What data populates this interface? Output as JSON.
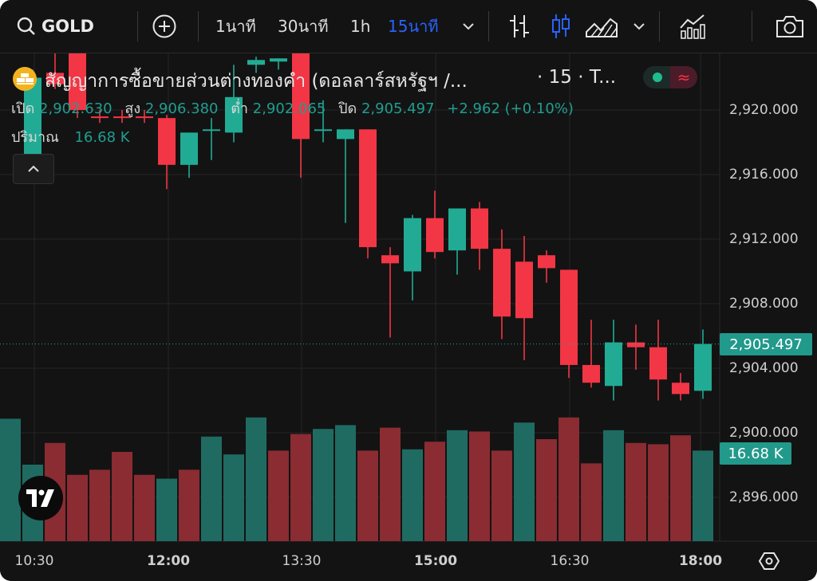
{
  "toolbar": {
    "symbol": "GOLD",
    "intervals": [
      "1นาที",
      "30นาที",
      "1h",
      "15นาที"
    ],
    "active_interval_color": "#2962ff",
    "icons": [
      "search-icon",
      "add-icon",
      "chevron-down-icon",
      "bar-chart-type-icon",
      "candlestick-icon",
      "area-chart-icon",
      "indicators-icon",
      "camera-icon"
    ]
  },
  "legend": {
    "title": "สัญญาการซื้อขายส่วนต่างทองคำ (ดอลลาร์สหรัฐฯ /...",
    "suffix": "· 15 · T...",
    "open_label": "เปิด",
    "open": "2,902.630",
    "high_label": "สูง",
    "high": "2,906.380",
    "low_label": "ต่ำ",
    "low": "2,902.065",
    "close_label": "ปิด",
    "close": "2,905.497",
    "change": "+2.962 (+0.10%)",
    "volume_label": "ปริมาณ",
    "volume": "16.68 K"
  },
  "price_badge": "2,905.497",
  "volume_badge": "16.68 K",
  "colors": {
    "up": "#22ab94",
    "down": "#f23645",
    "bg": "#131313",
    "grid": "#262626",
    "text": "#d1d4dc"
  },
  "chart_data": {
    "type": "candlestick",
    "x_ticks": [
      "10:30",
      "12:00",
      "13:30",
      "15:00",
      "16:30",
      "18:00"
    ],
    "y_ticks": [
      "2,920.000",
      "2,916.000",
      "2,912.000",
      "2,908.000",
      "2,904.000",
      "2,900.000",
      "2,896.000"
    ],
    "ylim": [
      2893.5,
      2924.8
    ],
    "last_price": 2905.497,
    "candles": [
      {
        "o": 2916.5,
        "h": 2922.5,
        "l": 2915.5,
        "c": 2922.0
      },
      {
        "o": 2922.3,
        "h": 2923.5,
        "l": 2921.3,
        "c": 2921.6
      },
      {
        "o": 2926.0,
        "h": 2926.5,
        "l": 2919.5,
        "c": 2920.0
      },
      {
        "o": 2919.6,
        "h": 2920.0,
        "l": 2919.2,
        "c": 2919.5
      },
      {
        "o": 2919.6,
        "h": 2920.0,
        "l": 2919.2,
        "c": 2919.5
      },
      {
        "o": 2919.6,
        "h": 2920.0,
        "l": 2919.2,
        "c": 2919.5
      },
      {
        "o": 2919.5,
        "h": 2919.7,
        "l": 2915.1,
        "c": 2916.6
      },
      {
        "o": 2916.6,
        "h": 2918.6,
        "l": 2915.8,
        "c": 2918.6
      },
      {
        "o": 2918.8,
        "h": 2919.5,
        "l": 2916.9,
        "c": 2918.8
      },
      {
        "o": 2918.6,
        "h": 2922.8,
        "l": 2918.0,
        "c": 2920.8
      },
      {
        "o": 2922.8,
        "h": 2923.3,
        "l": 2922.3,
        "c": 2923.1
      },
      {
        "o": 2923.0,
        "h": 2923.2,
        "l": 2922.5,
        "c": 2923.2
      },
      {
        "o": 2925.0,
        "h": 2925.5,
        "l": 2915.8,
        "c": 2918.2
      },
      {
        "o": 2918.8,
        "h": 2920.6,
        "l": 2918.0,
        "c": 2918.8
      },
      {
        "o": 2918.2,
        "h": 2918.8,
        "l": 2913.0,
        "c": 2918.8
      },
      {
        "o": 2918.8,
        "h": 2918.8,
        "l": 2910.8,
        "c": 2911.5
      },
      {
        "o": 2911.0,
        "h": 2911.5,
        "l": 2905.9,
        "c": 2910.5
      },
      {
        "o": 2910.0,
        "h": 2913.5,
        "l": 2908.2,
        "c": 2913.3
      },
      {
        "o": 2913.3,
        "h": 2915.0,
        "l": 2910.8,
        "c": 2911.2
      },
      {
        "o": 2911.3,
        "h": 2913.9,
        "l": 2909.8,
        "c": 2913.9
      },
      {
        "o": 2913.9,
        "h": 2914.3,
        "l": 2910.1,
        "c": 2911.4
      },
      {
        "o": 2911.4,
        "h": 2912.6,
        "l": 2905.8,
        "c": 2907.2
      },
      {
        "o": 2910.6,
        "h": 2912.2,
        "l": 2904.5,
        "c": 2907.1
      },
      {
        "o": 2911.0,
        "h": 2911.3,
        "l": 2909.3,
        "c": 2910.2
      },
      {
        "o": 2910.1,
        "h": 2910.1,
        "l": 2903.4,
        "c": 2904.2
      },
      {
        "o": 2904.2,
        "h": 2907.0,
        "l": 2902.8,
        "c": 2903.1
      },
      {
        "o": 2902.9,
        "h": 2907.0,
        "l": 2902.0,
        "c": 2905.6
      },
      {
        "o": 2905.6,
        "h": 2906.7,
        "l": 2903.9,
        "c": 2905.3
      },
      {
        "o": 2905.3,
        "h": 2907.0,
        "l": 2902.0,
        "c": 2903.3
      },
      {
        "o": 2903.1,
        "h": 2903.7,
        "l": 2902.0,
        "c": 2902.4
      },
      {
        "o": 2902.6,
        "h": 2906.4,
        "l": 2902.1,
        "c": 2905.5
      }
    ],
    "volumes": [
      {
        "v": 0.96,
        "up": true
      },
      {
        "v": 0.6,
        "up": true
      },
      {
        "v": 0.77,
        "up": false
      },
      {
        "v": 0.52,
        "up": false
      },
      {
        "v": 0.56,
        "up": false
      },
      {
        "v": 0.7,
        "up": false
      },
      {
        "v": 0.52,
        "up": false
      },
      {
        "v": 0.49,
        "up": true
      },
      {
        "v": 0.56,
        "up": false
      },
      {
        "v": 0.82,
        "up": true
      },
      {
        "v": 0.68,
        "up": true
      },
      {
        "v": 0.97,
        "up": true
      },
      {
        "v": 0.71,
        "up": false
      },
      {
        "v": 0.84,
        "up": false
      },
      {
        "v": 0.88,
        "up": true
      },
      {
        "v": 0.91,
        "up": true
      },
      {
        "v": 0.71,
        "up": false
      },
      {
        "v": 0.89,
        "up": false
      },
      {
        "v": 0.72,
        "up": true
      },
      {
        "v": 0.78,
        "up": false
      },
      {
        "v": 0.87,
        "up": true
      },
      {
        "v": 0.86,
        "up": false
      },
      {
        "v": 0.71,
        "up": false
      },
      {
        "v": 0.93,
        "up": true
      },
      {
        "v": 0.8,
        "up": false
      },
      {
        "v": 0.97,
        "up": false
      },
      {
        "v": 0.61,
        "up": false
      },
      {
        "v": 0.87,
        "up": true
      },
      {
        "v": 0.77,
        "up": false
      },
      {
        "v": 0.76,
        "up": false
      },
      {
        "v": 0.83,
        "up": false
      },
      {
        "v": 0.71,
        "up": true
      }
    ]
  }
}
